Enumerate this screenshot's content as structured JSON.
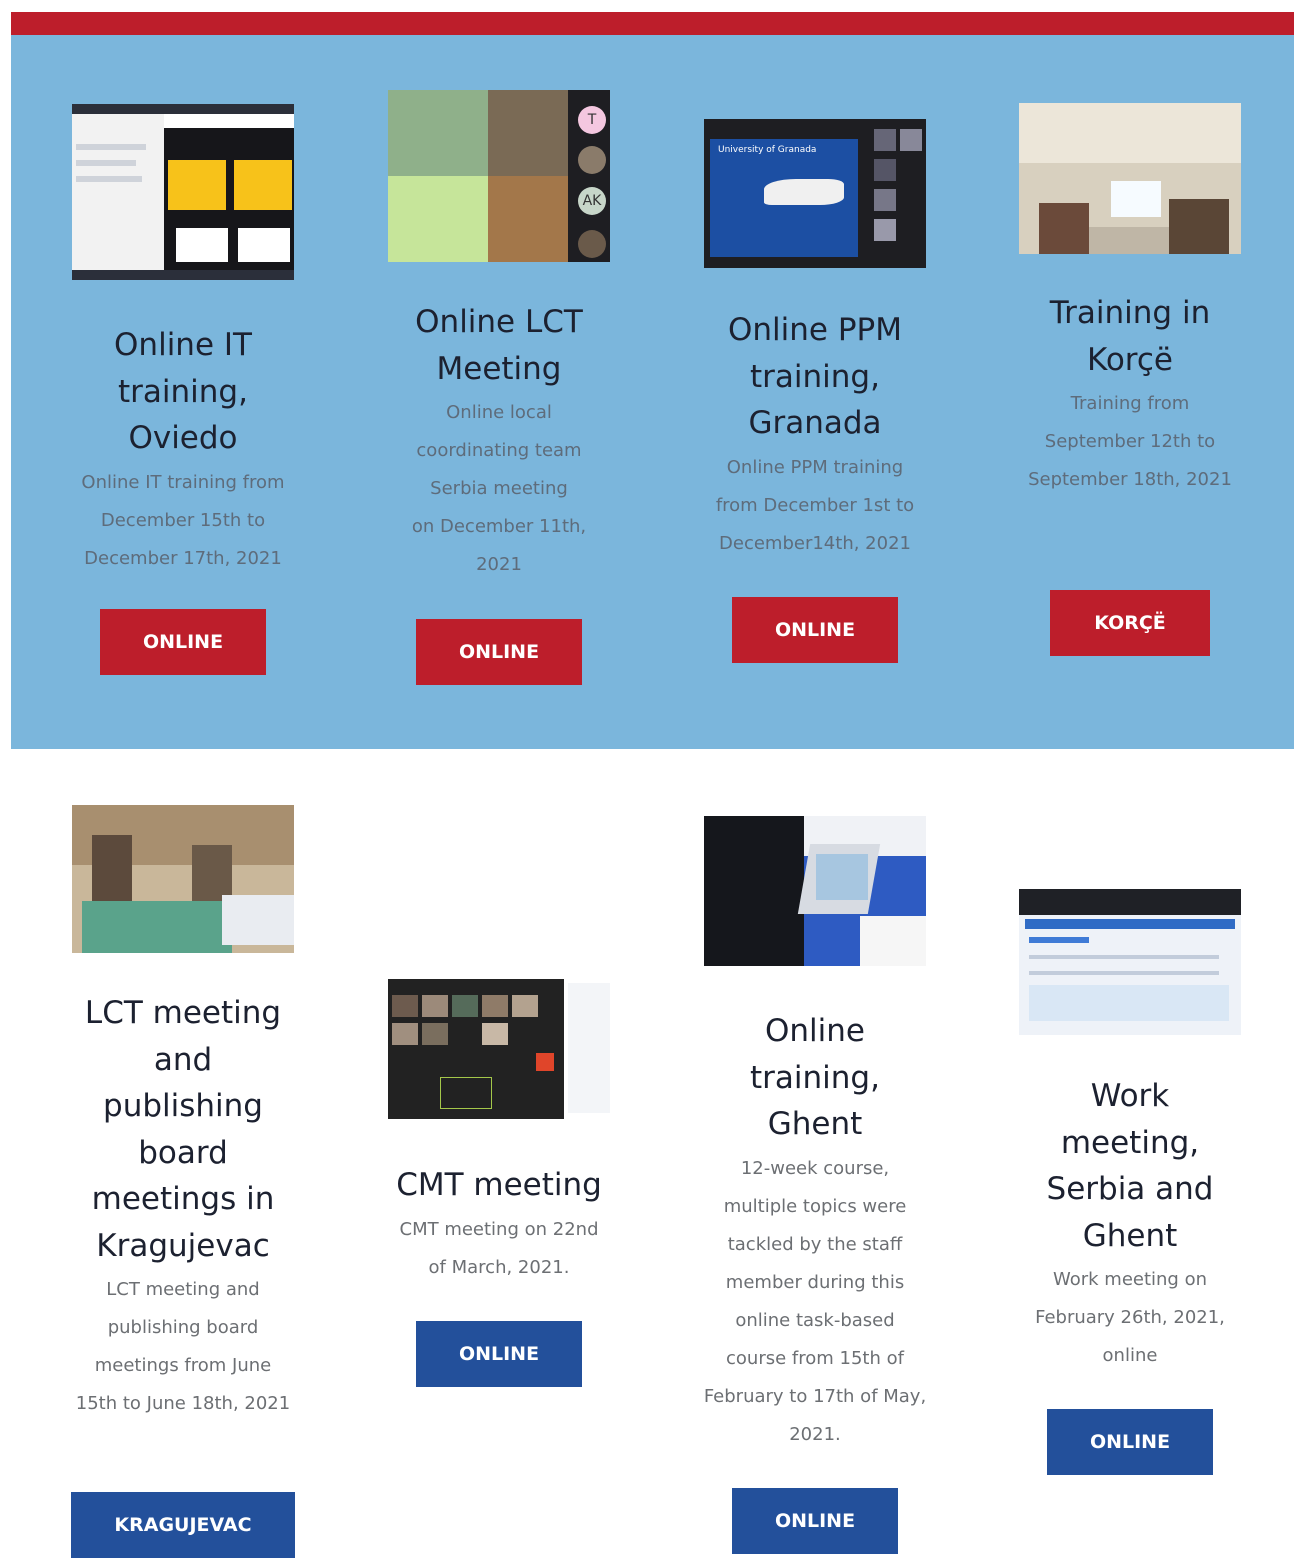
{
  "cards": [
    {
      "title": "Online IT training, Oviedo",
      "description": [
        "Online IT training from",
        "December 15th to",
        "December 17th, 2021"
      ],
      "button": "ONLINE"
    },
    {
      "title": "Online LCT Meeting",
      "description": [
        "Online local",
        "coordinating team",
        "Serbia meeting",
        "on December 11th,",
        "2021"
      ],
      "button": "ONLINE",
      "thumb_avatars": [
        "T",
        "AK"
      ]
    },
    {
      "title": "Online PPM training, Granada",
      "description": [
        "Online PPM training",
        "from December 1st to",
        "December14th, 2021"
      ],
      "button": "ONLINE",
      "thumb_slide_title": "University of Granada"
    },
    {
      "title": "Training in Korçë",
      "description": [
        "Training from",
        "September 12th to",
        "September 18th, 2021"
      ],
      "button": "KORÇË"
    },
    {
      "title": "LCT meeting and publishing board meetings in Kragujevac",
      "description": [
        "LCT meeting and",
        "publishing board",
        "meetings from June",
        "15th to June 18th, 2021"
      ],
      "button": "KRAGUJEVAC"
    },
    {
      "title": "CMT meeting",
      "description": [
        "CMT meeting on 22nd",
        "of March, 2021."
      ],
      "button": "ONLINE"
    },
    {
      "title": "Online training, Ghent",
      "description": [
        "12-week course,",
        "multiple topics were",
        "tackled by the staff",
        "member during this",
        "online task-based",
        "course from 15th of",
        "February to 17th of May,",
        "2021."
      ],
      "button": "ONLINE"
    },
    {
      "title": "Work meeting, Serbia and Ghent",
      "description": [
        "Work meeting on",
        "February 26th, 2021,",
        "online"
      ],
      "button": "ONLINE"
    }
  ],
  "colors": {
    "accent_red": "#bd1e2b",
    "band_blue": "#7bb6dc",
    "navy": "#23509b"
  }
}
